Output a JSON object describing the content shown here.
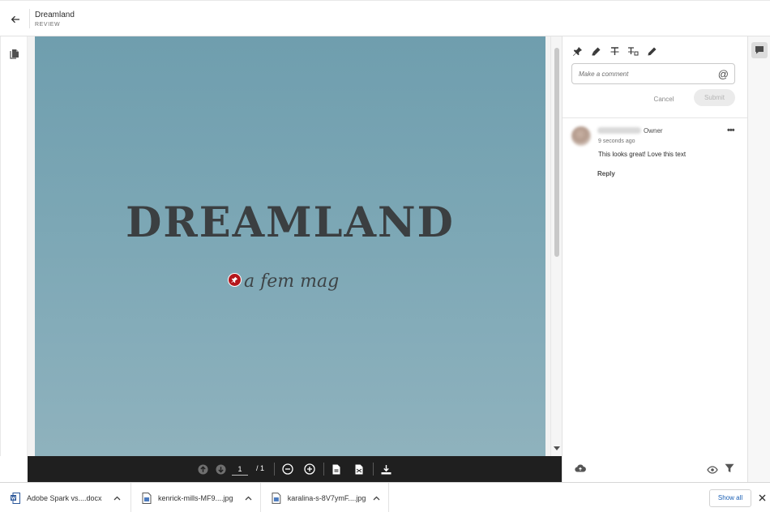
{
  "header": {
    "back_icon": "arrow-left-icon",
    "title": "Dreamland",
    "subtitle": "REVIEW"
  },
  "left_rail": {
    "pages_icon": "document-pages-icon"
  },
  "document": {
    "title": "DREAMLAND",
    "tagline": "a fem mag",
    "background": "#7ca7b5"
  },
  "toolbar": {
    "page_current": "1",
    "page_total": "/ 1",
    "icons": [
      "arrow-up-circle-icon",
      "arrow-down-circle-icon",
      "zoom-out-icon",
      "zoom-in-icon",
      "fit-page-icon",
      "fit-width-icon",
      "download-icon"
    ]
  },
  "comments_panel": {
    "tools": [
      "pin-icon",
      "highlighter-icon",
      "text-strikethrough-icon",
      "text-replace-icon",
      "pencil-icon"
    ],
    "input_placeholder": "Make a comment",
    "mention_symbol": "@",
    "cancel_label": "Cancel",
    "submit_label": "Submit",
    "comment": {
      "role": "Owner",
      "time": "9 seconds ago",
      "text": "This looks great! Love this text",
      "reply_label": "Reply",
      "more_label": "•••"
    },
    "footer_icons": [
      "cloud-upload-icon",
      "eye-icon",
      "filter-icon"
    ]
  },
  "right_rail": {
    "comment_icon": "speech-bubble-icon"
  },
  "downloads": {
    "items": [
      {
        "name": "Adobe Spark vs....docx",
        "icon": "word-document-icon"
      },
      {
        "name": "kenrick-mills-MF9....jpg",
        "icon": "image-file-icon"
      },
      {
        "name": "karalina-s-8V7ymF....jpg",
        "icon": "image-file-icon"
      }
    ],
    "show_all_label": "Show all",
    "close_icon": "close-icon"
  },
  "colors": {
    "accent_red": "#b5161b",
    "toolbar_dark": "#1f1f1f",
    "link_blue": "#1a5fb4"
  }
}
